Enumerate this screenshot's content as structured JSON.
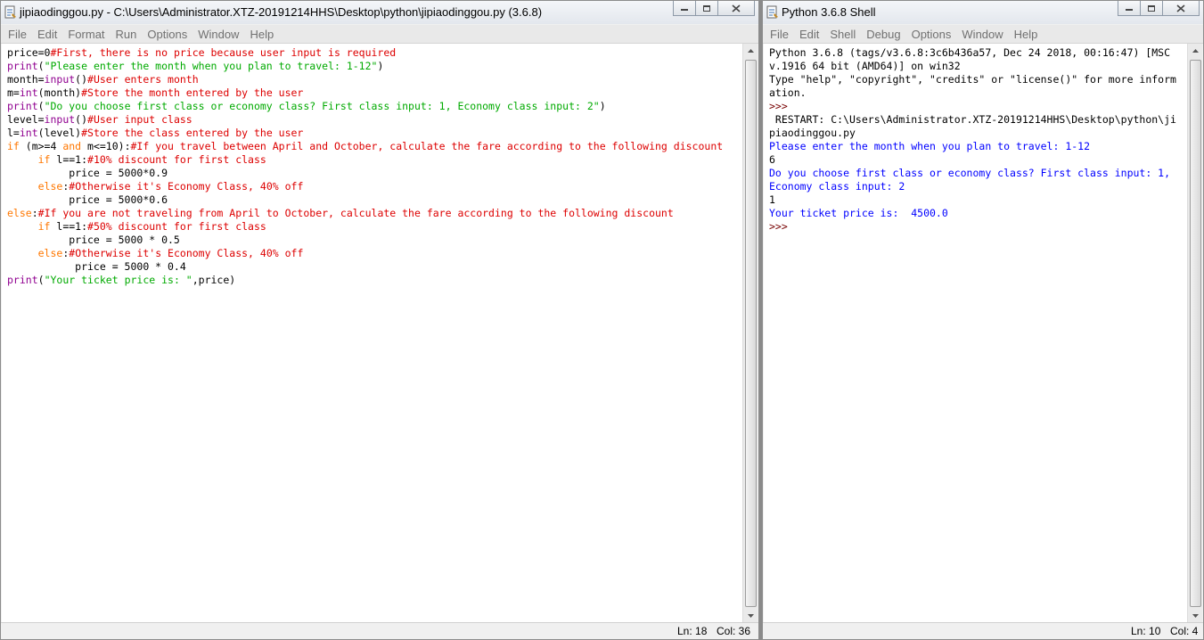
{
  "editor": {
    "title": "jipiaodinggou.py - C:\\Users\\Administrator.XTZ-20191214HHS\\Desktop\\python\\jipiaodinggou.py (3.6.8)",
    "menu": [
      "File",
      "Edit",
      "Format",
      "Run",
      "Options",
      "Window",
      "Help"
    ],
    "code_lines": [
      [
        {
          "t": "price=0",
          "c": "def"
        },
        {
          "t": "#First, there is no price because user input is required",
          "c": "com"
        }
      ],
      [
        {
          "t": "print",
          "c": "bi"
        },
        {
          "t": "(",
          "c": "def"
        },
        {
          "t": "\"Please enter the month when you plan to travel: 1-12\"",
          "c": "str"
        },
        {
          "t": ")",
          "c": "def"
        }
      ],
      [
        {
          "t": "month=",
          "c": "def"
        },
        {
          "t": "input",
          "c": "bi"
        },
        {
          "t": "()",
          "c": "def"
        },
        {
          "t": "#User enters month",
          "c": "com"
        }
      ],
      [
        {
          "t": "m=",
          "c": "def"
        },
        {
          "t": "int",
          "c": "bi"
        },
        {
          "t": "(month)",
          "c": "def"
        },
        {
          "t": "#Store the month entered by the user",
          "c": "com"
        }
      ],
      [
        {
          "t": "print",
          "c": "bi"
        },
        {
          "t": "(",
          "c": "def"
        },
        {
          "t": "\"Do you choose first class or economy class? First class input: 1, Economy class input: 2\"",
          "c": "str"
        },
        {
          "t": ")",
          "c": "def"
        }
      ],
      [
        {
          "t": "level=",
          "c": "def"
        },
        {
          "t": "input",
          "c": "bi"
        },
        {
          "t": "()",
          "c": "def"
        },
        {
          "t": "#User input class",
          "c": "com"
        }
      ],
      [
        {
          "t": "l=",
          "c": "def"
        },
        {
          "t": "int",
          "c": "bi"
        },
        {
          "t": "(level)",
          "c": "def"
        },
        {
          "t": "#Store the class entered by the user",
          "c": "com"
        }
      ],
      [
        {
          "t": "if",
          "c": "kw"
        },
        {
          "t": " (m>=4 ",
          "c": "def"
        },
        {
          "t": "and",
          "c": "kw"
        },
        {
          "t": " m<=10):",
          "c": "def"
        },
        {
          "t": "#If you travel between April and October, calculate the fare according to the following discount",
          "c": "com"
        }
      ],
      [
        {
          "t": "     ",
          "c": "def"
        },
        {
          "t": "if",
          "c": "kw"
        },
        {
          "t": " l==1:",
          "c": "def"
        },
        {
          "t": "#10% discount for first class",
          "c": "com"
        }
      ],
      [
        {
          "t": "          price = 5000*0.9",
          "c": "def"
        }
      ],
      [
        {
          "t": "     ",
          "c": "def"
        },
        {
          "t": "else",
          "c": "kw"
        },
        {
          "t": ":",
          "c": "def"
        },
        {
          "t": "#Otherwise it's Economy Class, 40% off",
          "c": "com"
        }
      ],
      [
        {
          "t": "          price = 5000*0.6",
          "c": "def"
        }
      ],
      [
        {
          "t": "else",
          "c": "kw"
        },
        {
          "t": ":",
          "c": "def"
        },
        {
          "t": "#If you are not traveling from April to October, calculate the fare according to the following discount",
          "c": "com"
        }
      ],
      [
        {
          "t": "     ",
          "c": "def"
        },
        {
          "t": "if",
          "c": "kw"
        },
        {
          "t": " l==1:",
          "c": "def"
        },
        {
          "t": "#50% discount for first class",
          "c": "com"
        }
      ],
      [
        {
          "t": "          price = 5000 * 0.5",
          "c": "def"
        }
      ],
      [
        {
          "t": "     ",
          "c": "def"
        },
        {
          "t": "else",
          "c": "kw"
        },
        {
          "t": ":",
          "c": "def"
        },
        {
          "t": "#Otherwise it's Economy Class, 40% off",
          "c": "com"
        }
      ],
      [
        {
          "t": "           price = 5000 * 0.4",
          "c": "def"
        }
      ],
      [
        {
          "t": "print",
          "c": "bi"
        },
        {
          "t": "(",
          "c": "def"
        },
        {
          "t": "\"Your ticket price is: \"",
          "c": "str"
        },
        {
          "t": ",price)",
          "c": "def"
        }
      ]
    ],
    "status_ln": "Ln: 18",
    "status_col": "Col: 36"
  },
  "shell": {
    "title": "Python 3.6.8 Shell",
    "menu": [
      "File",
      "Edit",
      "Shell",
      "Debug",
      "Options",
      "Window",
      "Help"
    ],
    "lines": [
      {
        "t": "Python 3.6.8 (tags/v3.6.8:3c6b436a57, Dec 24 2018, 00:16:47) [MSC",
        "c": "def"
      },
      {
        "t": "v.1916 64 bit (AMD64)] on win32",
        "c": "def"
      },
      {
        "t": "Type \"help\", \"copyright\", \"credits\" or \"license()\" for more inform",
        "c": "def"
      },
      {
        "t": "ation.",
        "c": "def"
      },
      {
        "t": ">>> ",
        "c": "prompt"
      },
      {
        "t": " RESTART: C:\\Users\\Administrator.XTZ-20191214HHS\\Desktop\\python\\ji",
        "c": "def"
      },
      {
        "t": "piaodinggou.py ",
        "c": "def"
      },
      {
        "t": "Please enter the month when you plan to travel: 1-12",
        "c": "out"
      },
      {
        "t": "6",
        "c": "in"
      },
      {
        "t": "Do you choose first class or economy class? First class input: 1,",
        "c": "out"
      },
      {
        "t": "Economy class input: 2",
        "c": "out"
      },
      {
        "t": "1",
        "c": "in"
      },
      {
        "t": "Your ticket price is:  4500.0",
        "c": "out"
      },
      {
        "t": ">>> ",
        "c": "prompt"
      }
    ],
    "status_ln": "Ln: 10",
    "status_col": "Col: 4"
  },
  "window_buttons": {
    "minimize": "minimize-icon",
    "maximize": "maximize-icon",
    "close": "close-icon"
  },
  "colors": {
    "keyword": "#ff7700",
    "builtin": "#900090",
    "string": "#00aa00",
    "comment": "#dd0000",
    "stdout": "#0000ff",
    "prompt": "#770000"
  }
}
